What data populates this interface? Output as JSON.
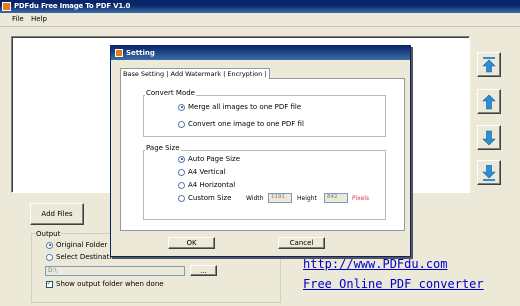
{
  "window": {
    "title": "PDFdu Free Image To PDF V1.0"
  },
  "menu": {
    "file": "File",
    "help": "Help"
  },
  "side_buttons": [
    {
      "icon": "arrow-top-icon"
    },
    {
      "icon": "arrow-up-icon"
    },
    {
      "icon": "arrow-down-icon"
    },
    {
      "icon": "arrow-bottom-icon"
    }
  ],
  "add_files": "Add Files",
  "output": {
    "legend": "Output",
    "original_folder": "Original Folder",
    "select_destination": "Select Destination",
    "path_value": "D:\\",
    "browse": "...",
    "show_output": "Show output folder when done"
  },
  "links": {
    "url": "http://www.PDFdu.com",
    "tagline": "Free Online PDF converter"
  },
  "dialog": {
    "title": "Setting",
    "tabs": [
      "Base Setting",
      "Add Watermark",
      "Encryption"
    ],
    "convert_mode": {
      "legend": "Convert Mode",
      "merge": "Merge all images to one PDF file",
      "one_each": "Convert one image to one PDF fil"
    },
    "page_size": {
      "legend": "Page Size",
      "auto": "Auto Page Size",
      "a4_vertical": "A4 Vertical",
      "a4_horizontal": "A4 Horizontal",
      "custom": "Custom Size",
      "width_label": "Width",
      "width_value": "1191",
      "height_label": "Height",
      "height_value": "842",
      "unit": "Pixels"
    },
    "ok": "OK",
    "cancel": "Cancel"
  },
  "colors": {
    "titlebar": "#0a246a",
    "arrow": "#2c8fd6",
    "pixels_label": "#e0324b",
    "link": "#0000cc"
  }
}
